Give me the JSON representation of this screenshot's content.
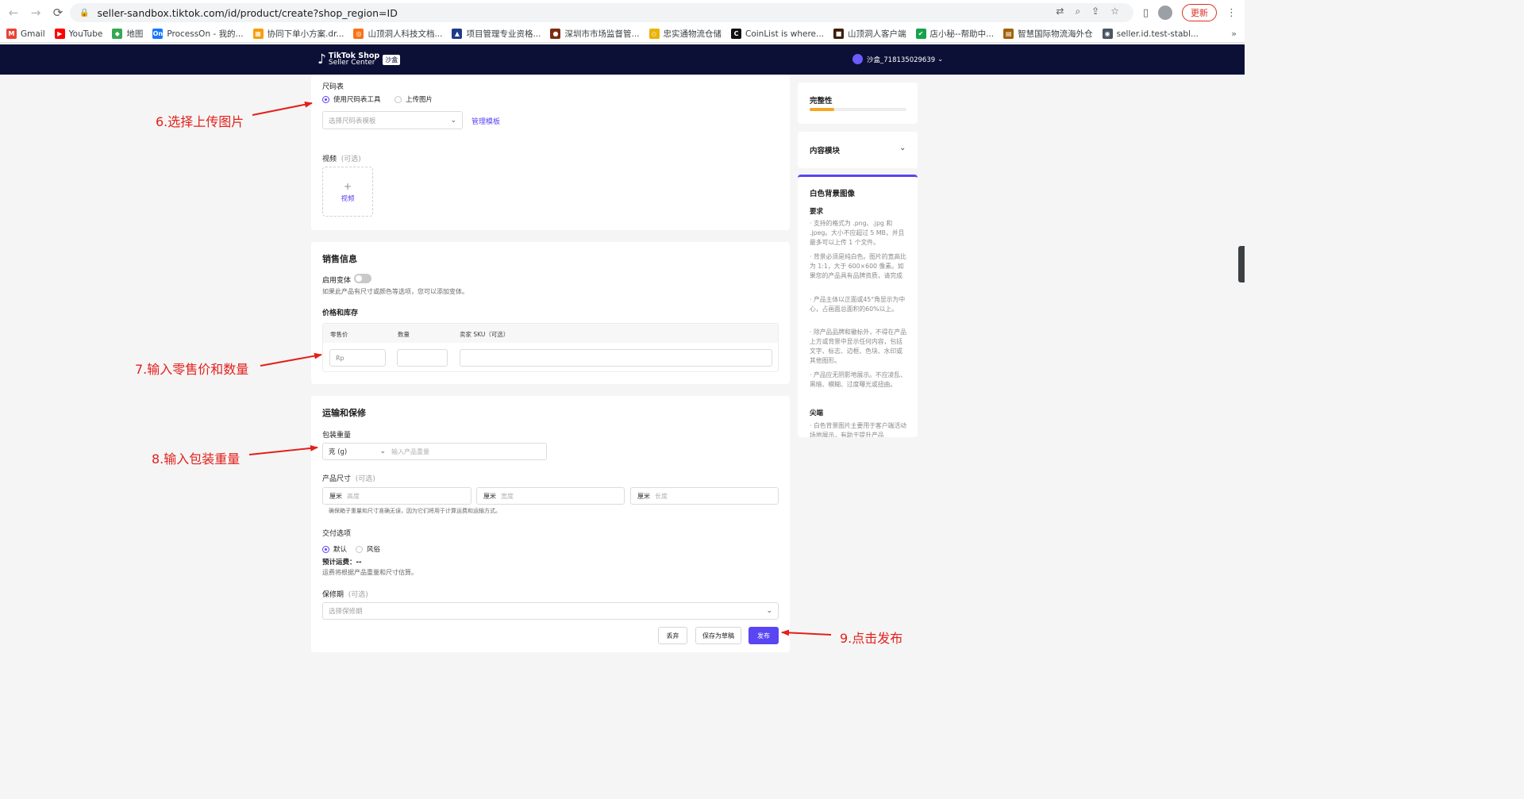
{
  "browser": {
    "url": "seller-sandbox.tiktok.com/id/product/create?shop_region=ID",
    "update_label": "更新",
    "bookmarks": [
      {
        "label": "Gmail",
        "color": "#ea4335",
        "glyph": "M"
      },
      {
        "label": "YouTube",
        "color": "#ff0000",
        "glyph": "▶"
      },
      {
        "label": "地图",
        "color": "#34a853",
        "glyph": "◆"
      },
      {
        "label": "ProcessOn - 我的...",
        "color": "#1677ff",
        "glyph": "On"
      },
      {
        "label": "协同下单小方案.dr...",
        "color": "#f59e0b",
        "glyph": "▦"
      },
      {
        "label": "山顶洞人科技文档...",
        "color": "#f97316",
        "glyph": "◎"
      },
      {
        "label": "项目管理专业资格...",
        "color": "#1e3a8a",
        "glyph": "▲"
      },
      {
        "label": "深圳市市场监督管...",
        "color": "#7c2d12",
        "glyph": "●"
      },
      {
        "label": "忠实通物流仓储",
        "color": "#eab308",
        "glyph": "◇"
      },
      {
        "label": "CoinList is where...",
        "color": "#111111",
        "glyph": "C"
      },
      {
        "label": "山顶洞人客户端",
        "color": "#3f1d0b",
        "glyph": "■"
      },
      {
        "label": "店小秘--帮助中...",
        "color": "#16a34a",
        "glyph": "✔"
      },
      {
        "label": "智慧国际物流海外仓",
        "color": "#a16207",
        "glyph": "▤"
      },
      {
        "label": "seller.id.test-stabl...",
        "color": "#4b5563",
        "glyph": "◉"
      }
    ],
    "bookmarks_more": "»"
  },
  "header": {
    "brand": "TikTok Shop",
    "brand_sub": "Seller Center",
    "badge": "沙盒",
    "user": "沙盒_718135029639"
  },
  "size_chart": {
    "label": "尺码表",
    "opt_tool": "使用尺码表工具",
    "opt_upload": "上传图片",
    "template_placeholder": "选择尺码表模板",
    "manage_link": "管理模板"
  },
  "video": {
    "label": "视频",
    "optional": "(可选)",
    "upload_label": "视频"
  },
  "sales": {
    "title": "销售信息",
    "variant_label": "启用变体",
    "variant_hint": "如果此产品有尺寸或颜色等选项，您可以添加变体。",
    "price_stock_label": "价格和库存",
    "col_price": "零售价",
    "col_qty": "数量",
    "col_sku": "卖家 SKU（可选）",
    "price_prefix": "Rp"
  },
  "shipping": {
    "title": "运输和保修",
    "weight_label": "包装重量",
    "weight_unit": "克 (g)",
    "weight_placeholder": "输入产品重量",
    "dim_label": "产品尺寸",
    "dim_optional": "(可选)",
    "dim_unit": "厘米",
    "dim_height": "高度",
    "dim_width": "宽度",
    "dim_length": "长度",
    "dim_hint": "确保箱子重量和尺寸准确无误，因为它们将用于计算运费和运输方式。",
    "delivery_label": "交付选项",
    "delivery_default": "默认",
    "delivery_custom": "风俗",
    "fee_label": "预计运费：",
    "fee_value": "--",
    "fee_hint": "运费将根据产品重量和尺寸估算。",
    "warranty_label": "保修期",
    "warranty_optional": "(可选)",
    "warranty_placeholder": "选择保修期"
  },
  "actions": {
    "discard": "丢弃",
    "save_draft": "保存为草稿",
    "publish": "发布"
  },
  "sidebar": {
    "completeness_label": "完整性",
    "completeness_fraction": 0.25,
    "content_modules_label": "内容模块",
    "guide_title": "白色背景图像",
    "req_label": "要求",
    "req_items": [
      "· 支持的格式为 .png、.jpg 和 .jpeg。大小不应超过 5 MB，并且最多可以上传 1 个文件。",
      "· 背景必须是纯白色。图片的宽高比为 1:1，大于 600×600 像素。如果您的产品具有品牌资质，请完成",
      "· 产品主体以正面或45°角显示为中心，占画面总面积的60%以上。",
      "· 除产品品牌和徽标外，不得在产品上方或背景中显示任何内容，包括文字、标志、边框、色块、水印或其他图形。",
      "· 产品应无阴影地展示。不应凌乱、黑暗、模糊、过度曝光或扭曲。"
    ],
    "tips_label": "尖端",
    "tips_items": [
      "· 白色背景图片主要用于客户端活动场地展示，有助于提升产品"
    ]
  },
  "annotations": {
    "step6": "6.选择上传图片",
    "step7": "7.输入零售价和数量",
    "step8": "8.输入包装重量",
    "step9": "9.点击发布"
  },
  "colors": {
    "brand_purple": "#5945f2",
    "header_navy": "#0d1036",
    "annotation_red": "#e3201b",
    "progress_orange": "#f5a623"
  }
}
